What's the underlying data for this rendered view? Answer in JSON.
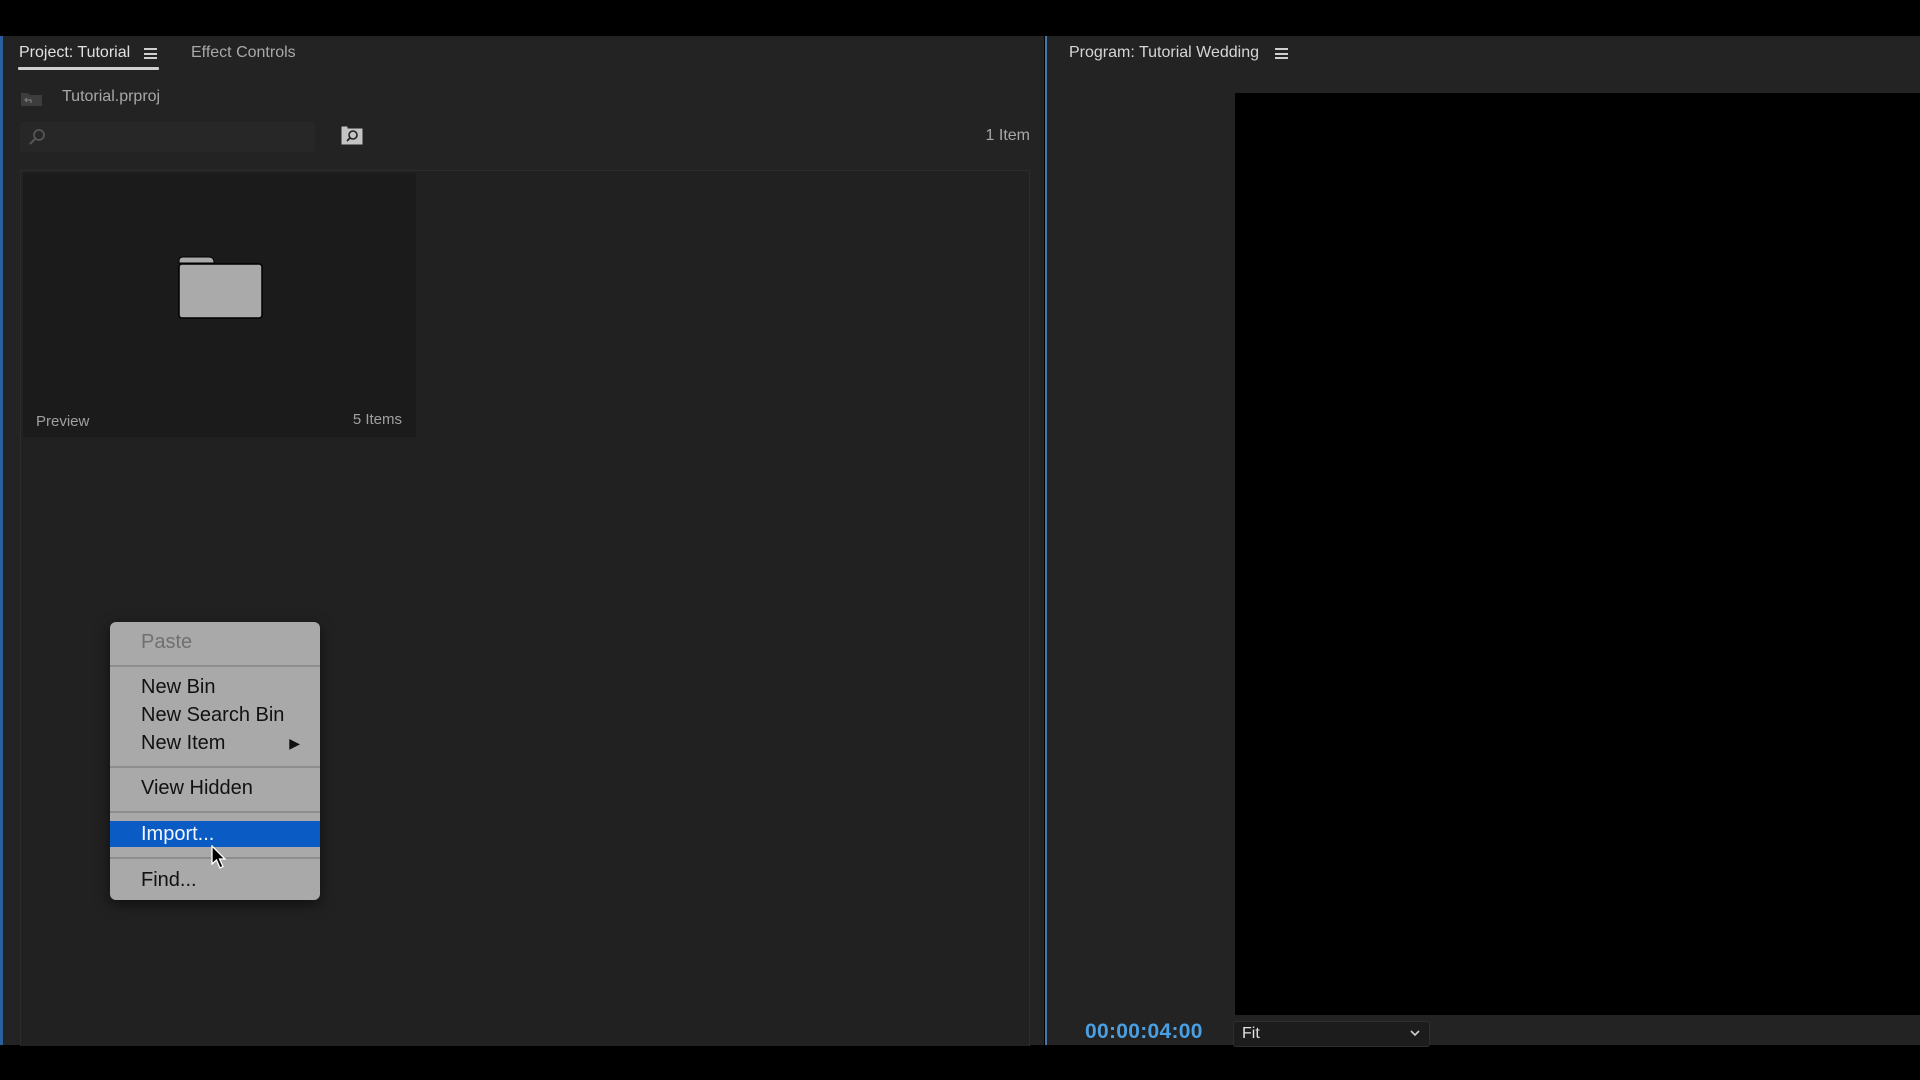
{
  "project_panel": {
    "tabs": [
      {
        "label": "Project: Tutorial",
        "active": true
      },
      {
        "label": "Effect Controls",
        "active": false
      }
    ],
    "menu_icon": "hamburger-menu-icon",
    "project_file": "Tutorial.prproj",
    "search": {
      "placeholder": "",
      "value": ""
    },
    "item_count": "1 Item",
    "bins": [
      {
        "name": "Preview",
        "count": "5 Items",
        "icon": "folder-icon"
      }
    ]
  },
  "context_menu": {
    "items": [
      {
        "label": "Paste",
        "disabled": true
      },
      {
        "label": "New Bin"
      },
      {
        "label": "New Search Bin"
      },
      {
        "label": "New Item",
        "submenu": true,
        "arrow": "▶"
      },
      {
        "label": "View Hidden"
      },
      {
        "label": "Import...",
        "highlighted": true
      },
      {
        "label": "Find..."
      }
    ],
    "highlight_color": "#0a5bc4"
  },
  "program_panel": {
    "title": "Program: Tutorial Wedding",
    "timecode": "00:00:04:00",
    "timecode_color": "#4a9fe2",
    "zoom_level": "Fit"
  }
}
